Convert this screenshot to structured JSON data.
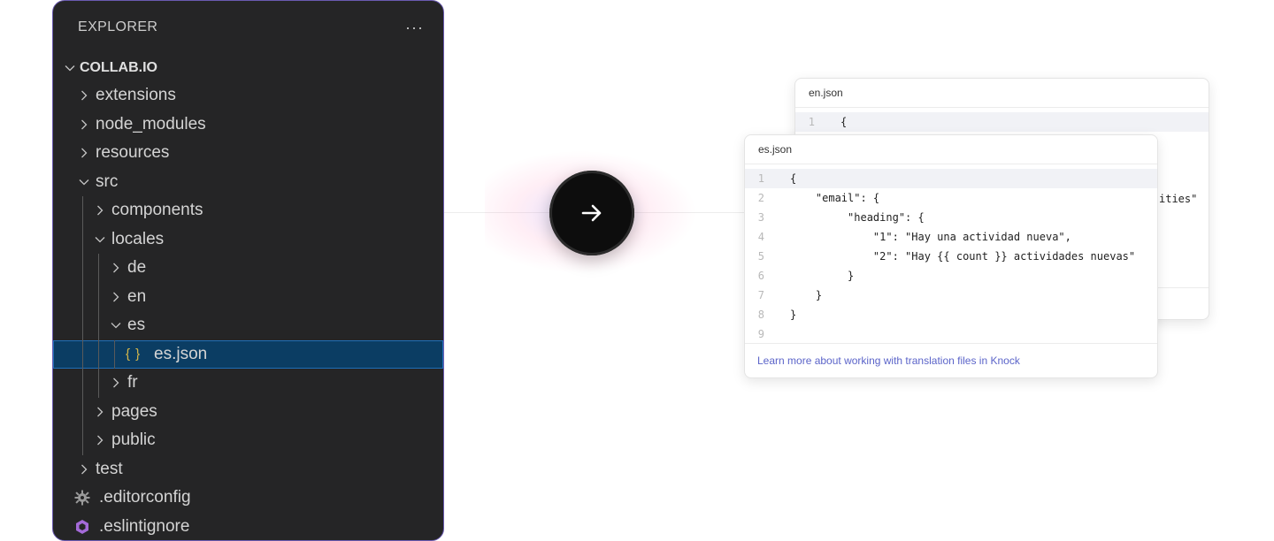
{
  "explorer": {
    "title": "EXPLORER",
    "more": "···",
    "root": "COLLAB.IO",
    "items": [
      {
        "label": "extensions",
        "depth": 0,
        "type": "folder",
        "open": false
      },
      {
        "label": "node_modules",
        "depth": 0,
        "type": "folder",
        "open": false
      },
      {
        "label": "resources",
        "depth": 0,
        "type": "folder",
        "open": false
      },
      {
        "label": "src",
        "depth": 0,
        "type": "folder",
        "open": true
      },
      {
        "label": "components",
        "depth": 1,
        "type": "folder",
        "open": false
      },
      {
        "label": "locales",
        "depth": 1,
        "type": "folder",
        "open": true
      },
      {
        "label": "de",
        "depth": 2,
        "type": "folder",
        "open": false
      },
      {
        "label": "en",
        "depth": 2,
        "type": "folder",
        "open": false
      },
      {
        "label": "es",
        "depth": 2,
        "type": "folder",
        "open": true
      },
      {
        "label": "es.json",
        "depth": 3,
        "type": "json",
        "selected": true,
        "icon": "{ }"
      },
      {
        "label": "fr",
        "depth": 2,
        "type": "folder",
        "open": false
      },
      {
        "label": "pages",
        "depth": 1,
        "type": "folder",
        "open": false
      },
      {
        "label": "public",
        "depth": 1,
        "type": "folder",
        "open": false
      },
      {
        "label": "test",
        "depth": 0,
        "type": "folder",
        "open": false
      },
      {
        "label": ".editorconfig",
        "depth": 0,
        "type": "gear"
      },
      {
        "label": ".eslintignore",
        "depth": 0,
        "type": "eslint"
      }
    ]
  },
  "arrow": {
    "icon": "arrow-right-icon"
  },
  "back_card": {
    "tab": "en.json",
    "lines": [
      {
        "n": "1",
        "text": "{"
      }
    ],
    "peek": "ities\""
  },
  "front_card": {
    "tab": "es.json",
    "lines": [
      {
        "n": "1",
        "text": "{"
      },
      {
        "n": "2",
        "text": "    \"email\": {"
      },
      {
        "n": "3",
        "text": "         \"heading\": {"
      },
      {
        "n": "4",
        "text": "             \"1\": \"Hay una actividad nueva\","
      },
      {
        "n": "5",
        "text": "             \"2\": \"Hay {{ count }} actividades nuevas\""
      },
      {
        "n": "6",
        "text": "         }"
      },
      {
        "n": "7",
        "text": "    }"
      },
      {
        "n": "8",
        "text": "}"
      },
      {
        "n": "9",
        "text": ""
      }
    ],
    "footer_link": "Learn more about working with translation files in Knock"
  },
  "colors": {
    "panel_bg": "#252526",
    "selected_bg": "#0b3d63",
    "json_icon": "#d7b84a",
    "link": "#5b64c9",
    "eslint_icon": "#a46ad8"
  }
}
